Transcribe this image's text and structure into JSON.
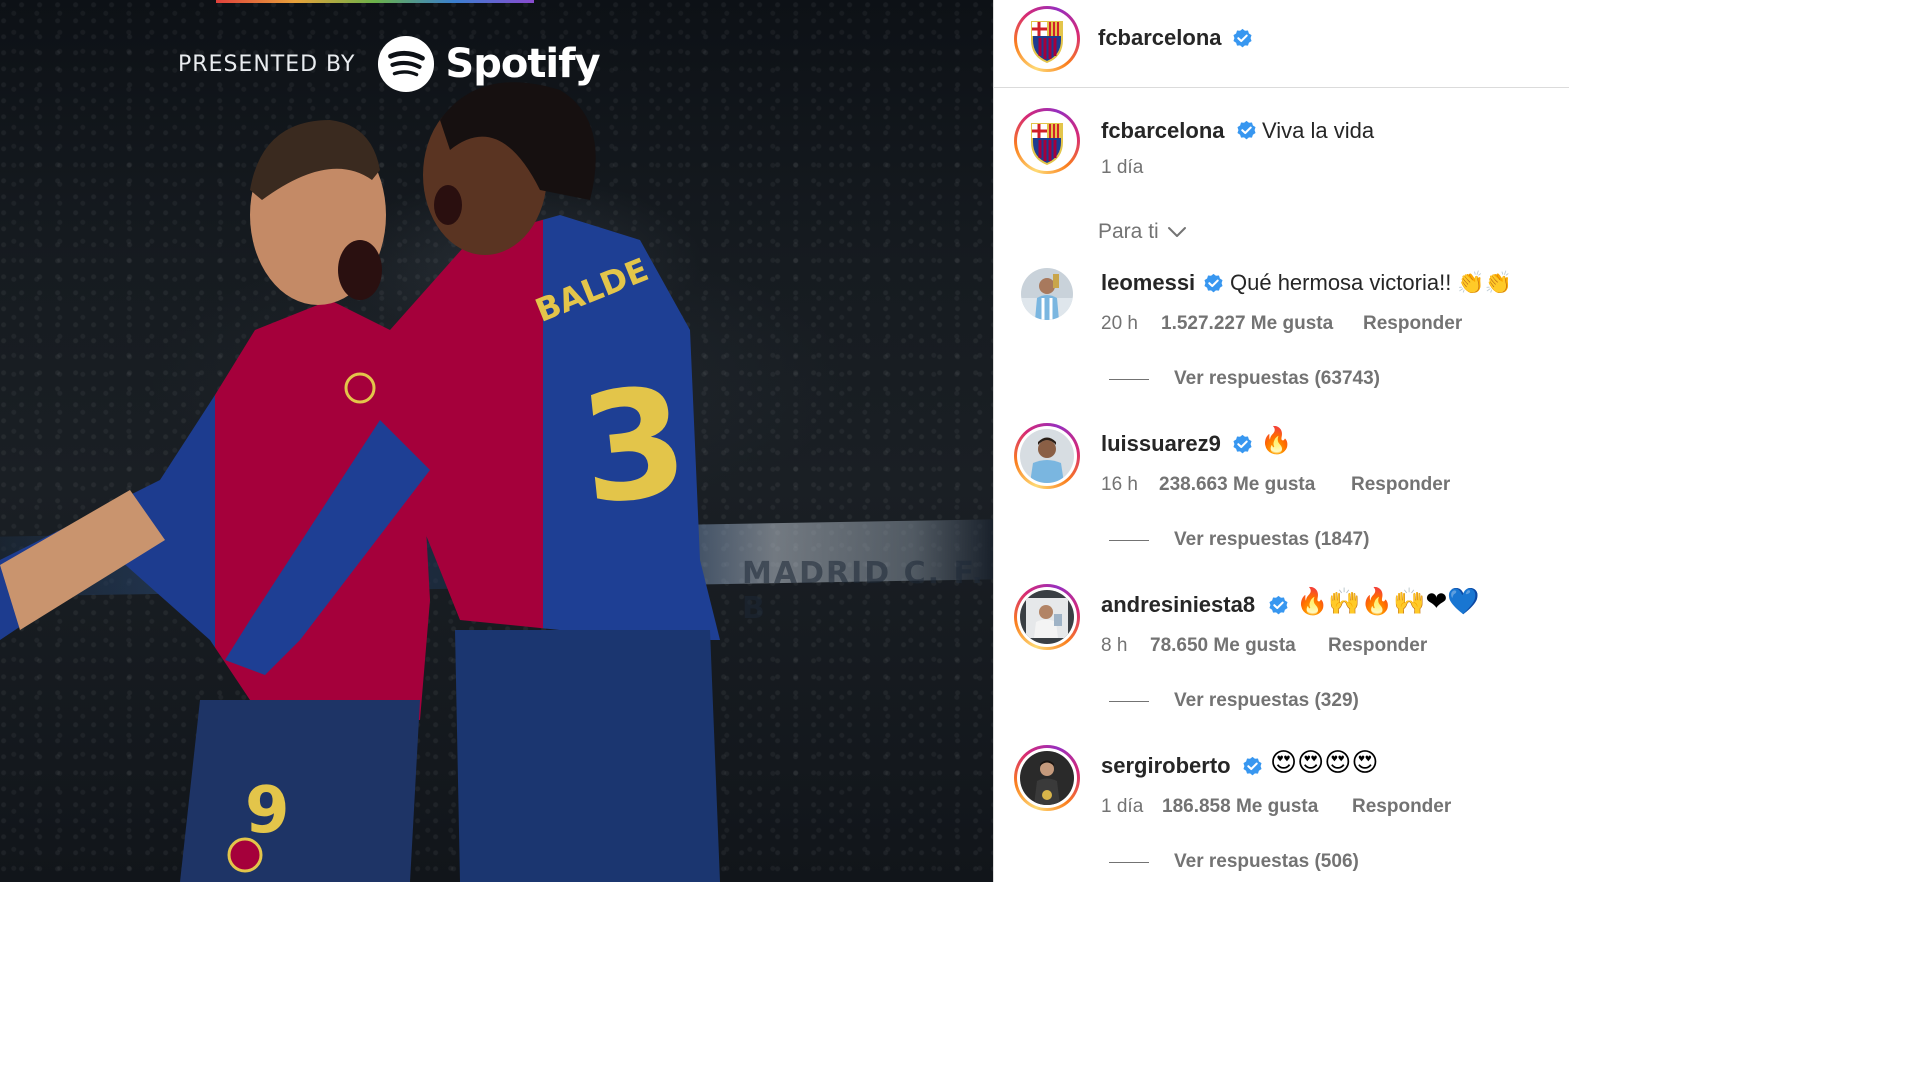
{
  "post": {
    "sponsor_label": "PRESENTED BY",
    "sponsor_brand": "Spotify",
    "jersey_name": "BALDE",
    "jersey_number_front": "3",
    "jersey_number_other": "9",
    "board_text": "MADRID C. F. B"
  },
  "header": {
    "username": "fcbarcelona"
  },
  "caption": {
    "username": "fcbarcelona",
    "text": "Viva la vida",
    "time": "1 día"
  },
  "sort": {
    "label": "Para ti"
  },
  "comments": [
    {
      "username": "leomessi",
      "text": "Qué hermosa victoria!! 👏👏",
      "time": "20 h",
      "likes": "1.527.227 Me gusta",
      "reply": "Responder",
      "view_replies": "Ver respuestas (63743)"
    },
    {
      "username": "luissuarez9",
      "text": "🔥",
      "time": "16 h",
      "likes": "238.663 Me gusta",
      "reply": "Responder",
      "view_replies": "Ver respuestas (1847)"
    },
    {
      "username": "andresiniesta8",
      "text": "🔥🙌🔥🙌❤💙",
      "time": "8 h",
      "likes": "78.650 Me gusta",
      "reply": "Responder",
      "view_replies": "Ver respuestas (329)"
    },
    {
      "username": "sergiroberto",
      "text": "😍😍😍😍",
      "time": "1 día",
      "likes": "186.858 Me gusta",
      "reply": "Responder",
      "view_replies": "Ver respuestas (506)"
    }
  ],
  "colors": {
    "verified": "#3897f0",
    "secondary_text": "#737373",
    "barca_blue": "#1d3c8f",
    "barca_red": "#a5003b"
  }
}
